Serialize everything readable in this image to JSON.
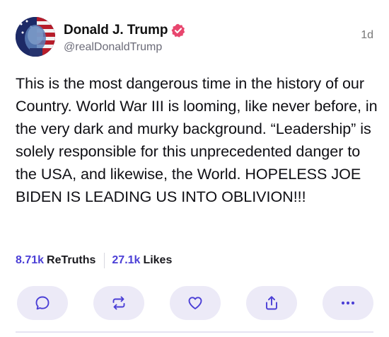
{
  "post": {
    "author": {
      "display_name": "Donald J. Trump",
      "handle": "@realDonaldTrump",
      "verified": true,
      "verified_color": "#e8466e"
    },
    "timestamp": "1d",
    "body": "This is the most dangerous time in the history of our Country. World War III is looming, like never before, in the very dark and murky background. “Leadership” is solely responsible for this unprecedented danger to the USA, and likewise, the World. HOPELESS JOE BIDEN IS LEADING US INTO OBLIVION!!!",
    "stats": {
      "retruths_count": "8.71k",
      "retruths_label": "ReTruths",
      "likes_count": "27.1k",
      "likes_label": "Likes"
    },
    "actions": [
      {
        "name": "reply",
        "icon": "comment-icon"
      },
      {
        "name": "retruth",
        "icon": "repost-icon"
      },
      {
        "name": "like",
        "icon": "heart-icon"
      },
      {
        "name": "share",
        "icon": "share-icon"
      },
      {
        "name": "more",
        "icon": "more-icon"
      }
    ]
  },
  "colors": {
    "accent": "#4b3fd6",
    "action_bg": "#eceaf7"
  }
}
